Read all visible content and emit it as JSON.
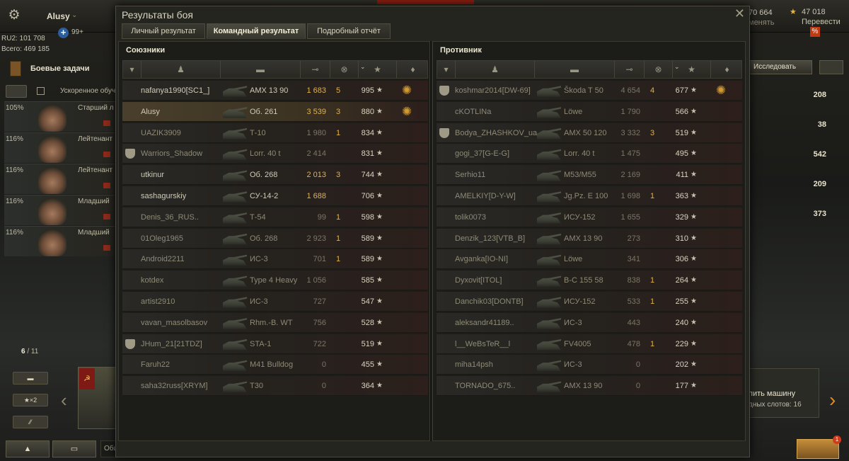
{
  "topbar": {
    "username": "Alusy",
    "premium_count": "99+",
    "ru_stat": "RU2: 101 708",
    "total_stat": "Всего: 469 185",
    "credits": "70 664",
    "credits_note": "менять",
    "gold": "47 018",
    "transfer": "Перевести",
    "percent": "%"
  },
  "left": {
    "missions_label": "Боевые задачи",
    "accel_label": "Ускоренное обуч",
    "crew": [
      {
        "pct": "105%",
        "rank": "Старший л"
      },
      {
        "pct": "116%",
        "rank": "Лейтенант"
      },
      {
        "pct": "116%",
        "rank": "Лейтенант"
      },
      {
        "pct": "116%",
        "rank": "Младший"
      },
      {
        "pct": "116%",
        "rank": "Младший"
      }
    ],
    "count_current": "6",
    "count_total": "/ 11",
    "x2_label": "★×2",
    "chat_placeholder": "Общ"
  },
  "right": {
    "research_label": "Исследовать",
    "stats": [
      "208",
      "38",
      "542",
      "209",
      "373"
    ],
    "buy_title": "пить машину",
    "buy_sub": "дных слотов: 16",
    "notif": "1"
  },
  "dialog": {
    "title": "Результаты боя",
    "tabs": [
      {
        "label": "Личный результат",
        "active": false
      },
      {
        "label": "Командный результат",
        "active": true
      },
      {
        "label": "Подробный отчёт",
        "active": false
      }
    ],
    "allies_title": "Союзники",
    "enemies_title": "Противник"
  },
  "allies": [
    {
      "name": "nafanya1990[SC1_]",
      "vehicle": "AMX 13 90",
      "damage": "1 683",
      "kills": "5",
      "xp": "995",
      "medal": true,
      "clan": false,
      "me": false,
      "dim": false
    },
    {
      "name": "Alusy",
      "vehicle": "Об. 261",
      "damage": "3 539",
      "kills": "3",
      "xp": "880",
      "medal": true,
      "clan": false,
      "me": true,
      "dim": false
    },
    {
      "name": "UAZIK3909",
      "vehicle": "Т-10",
      "damage": "1 980",
      "kills": "1",
      "xp": "834",
      "medal": false,
      "clan": false,
      "me": false,
      "dim": true
    },
    {
      "name": "Warriors_Shadow",
      "vehicle": "Lorr. 40 t",
      "damage": "2 414",
      "kills": "",
      "xp": "831",
      "medal": false,
      "clan": true,
      "me": false,
      "dim": true
    },
    {
      "name": "utkinur",
      "vehicle": "Об. 268",
      "damage": "2 013",
      "kills": "3",
      "xp": "744",
      "medal": false,
      "clan": false,
      "me": false,
      "dim": false
    },
    {
      "name": "sashagurskiy",
      "vehicle": "СУ-14-2",
      "damage": "1 688",
      "kills": "",
      "xp": "706",
      "medal": false,
      "clan": false,
      "me": false,
      "dim": false
    },
    {
      "name": "Denis_36_RUS..",
      "vehicle": "Т-54",
      "damage": "99",
      "kills": "1",
      "xp": "598",
      "medal": false,
      "clan": false,
      "me": false,
      "dim": true
    },
    {
      "name": "01Oleg1965",
      "vehicle": "Об. 268",
      "damage": "2 923",
      "kills": "1",
      "xp": "589",
      "medal": false,
      "clan": false,
      "me": false,
      "dim": true
    },
    {
      "name": "Android2211",
      "vehicle": "ИС-3",
      "damage": "701",
      "kills": "1",
      "xp": "589",
      "medal": false,
      "clan": false,
      "me": false,
      "dim": true
    },
    {
      "name": "kotdex",
      "vehicle": "Type 4 Heavy",
      "damage": "1 056",
      "kills": "",
      "xp": "585",
      "medal": false,
      "clan": false,
      "me": false,
      "dim": true
    },
    {
      "name": "artist2910",
      "vehicle": "ИС-3",
      "damage": "727",
      "kills": "",
      "xp": "547",
      "medal": false,
      "clan": false,
      "me": false,
      "dim": true
    },
    {
      "name": "vavan_masolbasov",
      "vehicle": "Rhm.-B. WT",
      "damage": "756",
      "kills": "",
      "xp": "528",
      "medal": false,
      "clan": false,
      "me": false,
      "dim": true
    },
    {
      "name": "JHum_21[21TDZ]",
      "vehicle": "STA-1",
      "damage": "722",
      "kills": "",
      "xp": "519",
      "medal": false,
      "clan": true,
      "me": false,
      "dim": true
    },
    {
      "name": "Faruh22",
      "vehicle": "M41 Bulldog",
      "damage": "0",
      "kills": "",
      "xp": "455",
      "medal": false,
      "clan": false,
      "me": false,
      "dim": true
    },
    {
      "name": "saha32russ[XRYM]",
      "vehicle": "T30",
      "damage": "0",
      "kills": "",
      "xp": "364",
      "medal": false,
      "clan": false,
      "me": false,
      "dim": true
    }
  ],
  "enemies": [
    {
      "name": "koshmar2014[DW-69]",
      "vehicle": "Škoda T 50",
      "damage": "4 654",
      "kills": "4",
      "xp": "677",
      "medal": true,
      "clan": true,
      "me": false,
      "dim": true
    },
    {
      "name": "cKOTLINa",
      "vehicle": "Löwe",
      "damage": "1 790",
      "kills": "",
      "xp": "566",
      "medal": false,
      "clan": false,
      "me": false,
      "dim": true
    },
    {
      "name": "Bodya_ZHASHKOV_ua",
      "vehicle": "AMX 50 120",
      "damage": "3 332",
      "kills": "3",
      "xp": "519",
      "medal": false,
      "clan": true,
      "me": false,
      "dim": true
    },
    {
      "name": "gogi_37[G-E-G]",
      "vehicle": "Lorr. 40 t",
      "damage": "1 475",
      "kills": "",
      "xp": "495",
      "medal": false,
      "clan": false,
      "me": false,
      "dim": true
    },
    {
      "name": "Serhio11",
      "vehicle": "M53/M55",
      "damage": "2 169",
      "kills": "",
      "xp": "411",
      "medal": false,
      "clan": false,
      "me": false,
      "dim": true
    },
    {
      "name": "AMELKIY[D-Y-W]",
      "vehicle": "Jg.Pz. E 100",
      "damage": "1 698",
      "kills": "1",
      "xp": "363",
      "medal": false,
      "clan": false,
      "me": false,
      "dim": true
    },
    {
      "name": "tolik0073",
      "vehicle": "ИСУ-152",
      "damage": "1 655",
      "kills": "",
      "xp": "329",
      "medal": false,
      "clan": false,
      "me": false,
      "dim": true
    },
    {
      "name": "Denzik_123[VTB_B]",
      "vehicle": "AMX 13 90",
      "damage": "273",
      "kills": "",
      "xp": "310",
      "medal": false,
      "clan": false,
      "me": false,
      "dim": true
    },
    {
      "name": "Avganka[IO-NI]",
      "vehicle": "Löwe",
      "damage": "341",
      "kills": "",
      "xp": "306",
      "medal": false,
      "clan": false,
      "me": false,
      "dim": true
    },
    {
      "name": "Dyxovit[ITOL]",
      "vehicle": "B-C 155 58",
      "damage": "838",
      "kills": "1",
      "xp": "264",
      "medal": false,
      "clan": false,
      "me": false,
      "dim": true
    },
    {
      "name": "Danchik03[DONTB]",
      "vehicle": "ИСУ-152",
      "damage": "533",
      "kills": "1",
      "xp": "255",
      "medal": false,
      "clan": false,
      "me": false,
      "dim": true
    },
    {
      "name": "aleksandr41189..",
      "vehicle": "ИС-3",
      "damage": "443",
      "kills": "",
      "xp": "240",
      "medal": false,
      "clan": false,
      "me": false,
      "dim": true
    },
    {
      "name": "l__WeBsTeR__l",
      "vehicle": "FV4005",
      "damage": "478",
      "kills": "1",
      "xp": "229",
      "medal": false,
      "clan": false,
      "me": false,
      "dim": true
    },
    {
      "name": "miha14psh",
      "vehicle": "ИС-3",
      "damage": "0",
      "kills": "",
      "xp": "202",
      "medal": false,
      "clan": false,
      "me": false,
      "dim": true
    },
    {
      "name": "TORNADO_675..",
      "vehicle": "AMX 13 90",
      "damage": "0",
      "kills": "",
      "xp": "177",
      "medal": false,
      "clan": false,
      "me": false,
      "dim": true
    }
  ],
  "icons": {
    "star": "★",
    "close": "✕",
    "medal": "✺",
    "gear": "⚙",
    "arrow_left": "‹",
    "arrow_right": "›"
  }
}
